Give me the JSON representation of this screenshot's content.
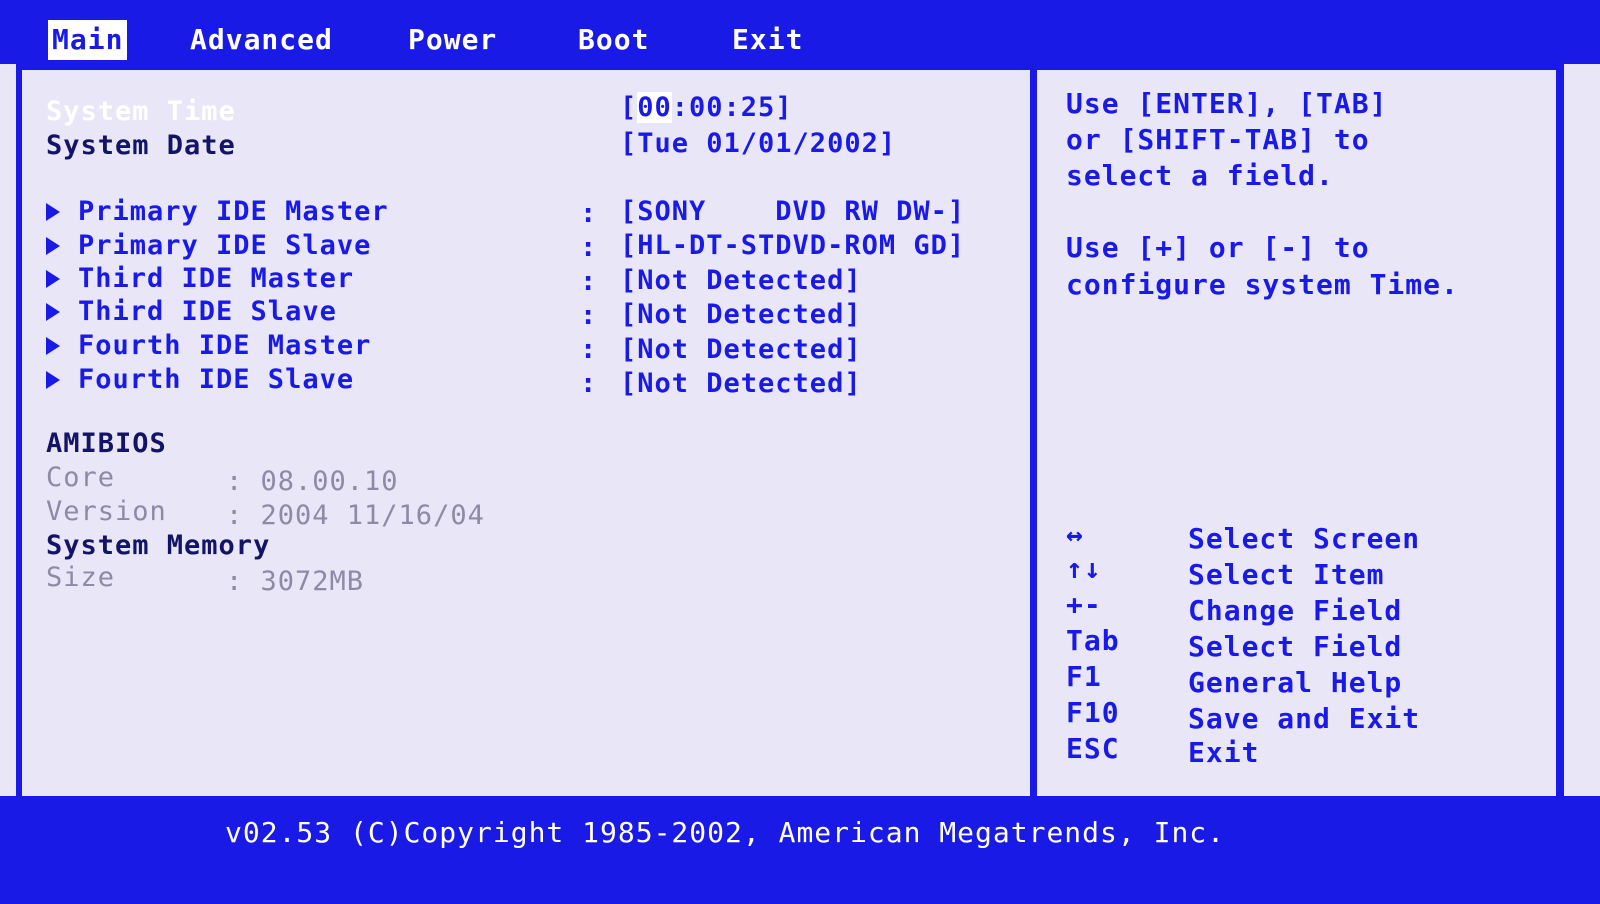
{
  "menu": {
    "tabs": [
      "Main",
      "Advanced",
      "Power",
      "Boot",
      "Exit"
    ],
    "active": "Main"
  },
  "main": {
    "system_time_label": "System Time",
    "system_time_cursor": "00",
    "system_time_rest": ":00:25]",
    "system_time_open": "[",
    "system_date_label": "System Date",
    "system_date_value": "[Tue 01/01/2002]",
    "drives": [
      {
        "label": "Primary IDE Master",
        "value": "[SONY    DVD RW DW-]"
      },
      {
        "label": "Primary IDE Slave",
        "value": "[HL-DT-STDVD-ROM GD]"
      },
      {
        "label": "Third IDE Master",
        "value": "[Not Detected]"
      },
      {
        "label": "Third IDE Slave",
        "value": "[Not Detected]"
      },
      {
        "label": "Fourth IDE Master",
        "value": "[Not Detected]"
      },
      {
        "label": "Fourth IDE Slave",
        "value": "[Not Detected]"
      }
    ],
    "separator": ":",
    "amibios_heading": "AMIBIOS",
    "core_label": "Core",
    "core_value": ": 08.00.10",
    "version_label": "Version",
    "version_value": ": 2004 11/16/04",
    "memory_heading": "System Memory",
    "size_label": "Size",
    "size_value": ": 3072MB"
  },
  "help": {
    "line1": "Use [ENTER], [TAB]",
    "line2": "or [SHIFT-TAB] to",
    "line3": "select a field.",
    "line4": "Use [+] or [-] to",
    "line5": "configure system Time."
  },
  "keys": [
    {
      "key": "↔",
      "desc": "Select Screen"
    },
    {
      "key": "↑↓",
      "desc": "Select Item"
    },
    {
      "key": "+-",
      "desc": "Change Field"
    },
    {
      "key": "Tab",
      "desc": "Select Field"
    },
    {
      "key": "F1",
      "desc": "General Help"
    },
    {
      "key": "F10",
      "desc": "Save and Exit"
    },
    {
      "key": "ESC",
      "desc": "Exit"
    }
  ],
  "footer": {
    "text": "v02.53 (C)Copyright 1985-2002, American Megatrends, Inc."
  },
  "colors": {
    "primary_blue": "#1a1ae6",
    "background": "#e9e6f8",
    "dim_text": "#8d8aa6"
  }
}
